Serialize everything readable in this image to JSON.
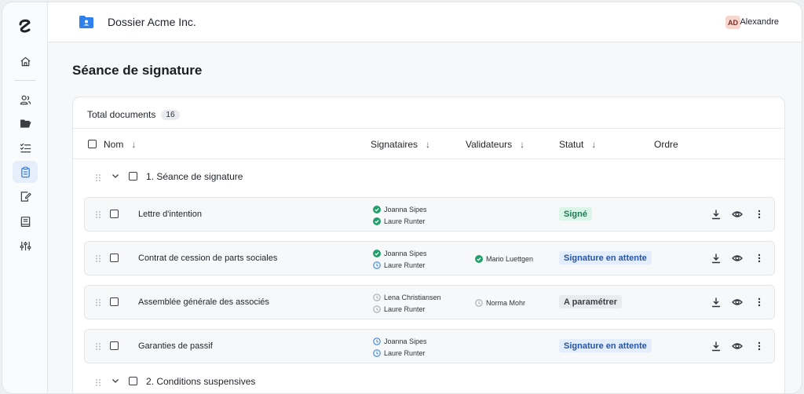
{
  "header": {
    "title": "Dossier Acme Inc.",
    "user_initials": "AD",
    "user_name": "Alexandre"
  },
  "page": {
    "title": "Séance de signature"
  },
  "summary": {
    "label": "Total documents",
    "count": "16"
  },
  "columns": {
    "name": "Nom",
    "signers": "Signataires",
    "validators": "Validateurs",
    "status": "Statut",
    "order": "Ordre"
  },
  "groups": [
    {
      "label": "1. Séance de signature"
    },
    {
      "label": "2. Conditions suspensives"
    }
  ],
  "rows": [
    {
      "name": "Lettre d'intention",
      "signers": [
        {
          "name": "Joanna Sipes",
          "state": "signed"
        },
        {
          "name": "Laure Runter",
          "state": "signed"
        }
      ],
      "validators": [],
      "status": "Signé",
      "status_kind": "ok"
    },
    {
      "name": "Contrat de cession de parts sociales",
      "signers": [
        {
          "name": "Joanna Sipes",
          "state": "signed"
        },
        {
          "name": "Laure Runter",
          "state": "pending"
        }
      ],
      "validators": [
        {
          "name": "Mario Luettgen",
          "state": "signed"
        }
      ],
      "status": "Signature en attente",
      "status_kind": "wait"
    },
    {
      "name": "Assemblée générale des associés",
      "signers": [
        {
          "name": "Lena Christiansen",
          "state": "idle"
        },
        {
          "name": "Laure Runter",
          "state": "idle"
        }
      ],
      "validators": [
        {
          "name": "Norma Mohr",
          "state": "idle"
        }
      ],
      "status": "A paramétrer",
      "status_kind": "todo"
    },
    {
      "name": "Garanties de passif",
      "signers": [
        {
          "name": "Joanna Sipes",
          "state": "pending"
        },
        {
          "name": "Laure Runter",
          "state": "pending"
        }
      ],
      "validators": [],
      "status": "Signature en attente",
      "status_kind": "wait"
    }
  ],
  "colors": {
    "signed": "#22a06b",
    "pending": "#3b82e6",
    "idle": "#a4a9b0",
    "accent": "#2f80ed"
  },
  "icons": {
    "sidebar": [
      "home-icon",
      "users-icon",
      "folder-open-icon",
      "checklist-icon",
      "clipboard-icon",
      "edit-document-icon",
      "book-icon",
      "sliders-icon"
    ],
    "row_actions": [
      "download-icon",
      "eye-icon",
      "more-vertical-icon"
    ]
  }
}
